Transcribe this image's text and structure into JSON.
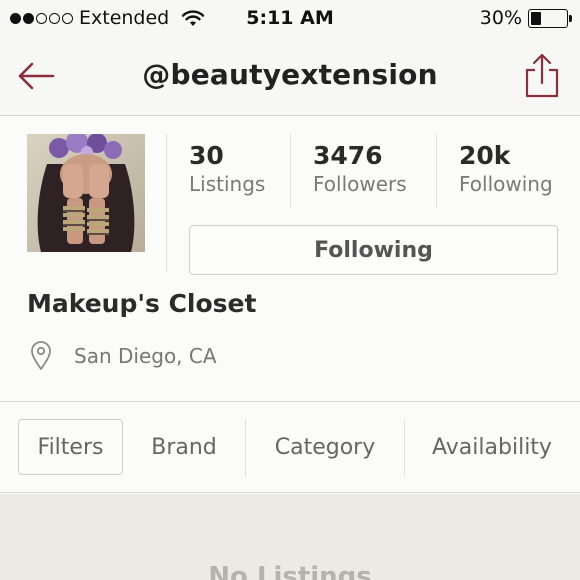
{
  "status_bar": {
    "carrier": "Extended",
    "signal_strength": 2,
    "signal_total": 5,
    "time": "5:11 AM",
    "battery_text": "30%",
    "battery_level": 0.3
  },
  "nav": {
    "title": "@beautyextension",
    "accent_color": "#8a2f3b"
  },
  "profile": {
    "stats": [
      {
        "value": "30",
        "label": "Listings"
      },
      {
        "value": "3476",
        "label": "Followers"
      },
      {
        "value": "20k",
        "label": "Following"
      }
    ],
    "follow_button_label": "Following",
    "closet_name": "Makeup's Closet",
    "location": "San Diego, CA"
  },
  "filters": {
    "items": [
      {
        "label": "Filters"
      },
      {
        "label": "Brand"
      },
      {
        "label": "Category"
      },
      {
        "label": "Availability"
      }
    ]
  },
  "content": {
    "empty_message": "No Listings"
  }
}
